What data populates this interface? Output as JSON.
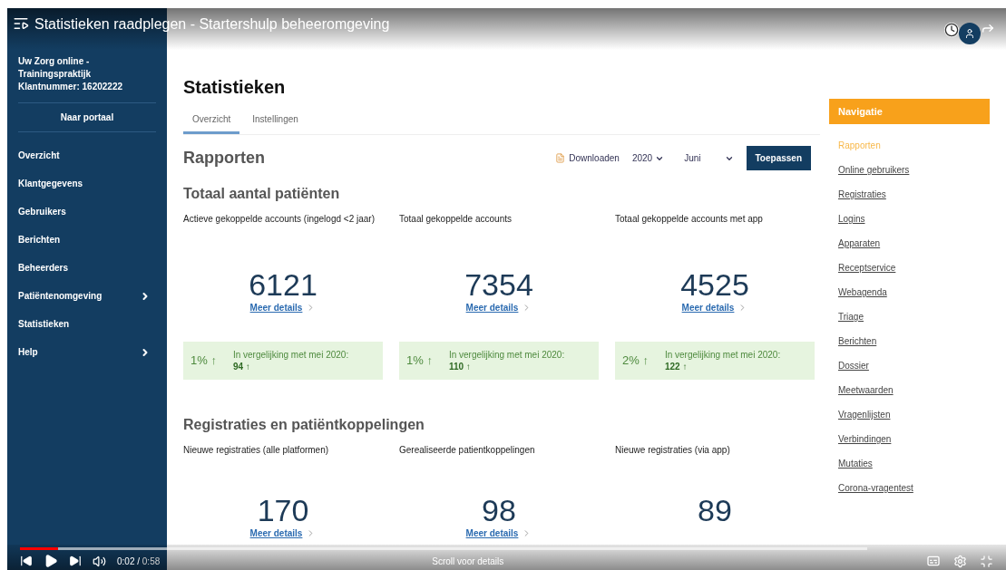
{
  "video": {
    "title": "Statistieken raadplegen - Startershulp beheeromgeving",
    "time_current": "0:02",
    "time_separator": "/",
    "time_total": "0:58",
    "progress": {
      "level": 0.045
    },
    "hint": "Scroll voor details"
  },
  "sidebar": {
    "organisation": "Uw Zorg online - Trainingspraktijk",
    "customer_number": "Klantnummer: 16202222",
    "portal_button": "Naar portaal",
    "items": [
      {
        "label": "Overzicht",
        "submenu": false
      },
      {
        "label": "Klantgegevens",
        "submenu": false
      },
      {
        "label": "Gebruikers",
        "submenu": false
      },
      {
        "label": "Berichten",
        "submenu": false
      },
      {
        "label": "Beheerders",
        "submenu": false
      },
      {
        "label": "Patiëntenomgeving",
        "submenu": true
      },
      {
        "label": "Statistieken",
        "submenu": false
      },
      {
        "label": "Help",
        "submenu": true
      }
    ]
  },
  "page": {
    "title": "Statistieken",
    "tabs": [
      {
        "label": "Overzicht",
        "selected": true
      },
      {
        "label": "Instellingen",
        "selected": false
      }
    ],
    "section_title": "Rapporten",
    "download": "Downloaden",
    "year": "2020",
    "month": "Juni",
    "apply_button": "Toepassen",
    "groups": [
      {
        "title": "Totaal aantal patiënten",
        "stats": [
          {
            "label": "Actieve gekoppelde accounts (ingelogd <2 jaar)",
            "value": "6121",
            "link": "Meer details",
            "change": {
              "percent": "1%",
              "arrow": "↑",
              "text": "In vergelijking met mei 2020:",
              "delta": "94",
              "delta_arrow": "↑"
            }
          },
          {
            "label": "Totaal gekoppelde accounts",
            "value": "7354",
            "link": "Meer details",
            "change": {
              "percent": "1%",
              "arrow": "↑",
              "text": "In vergelijking met mei 2020:",
              "delta": "110",
              "delta_arrow": "↑"
            }
          },
          {
            "label": "Totaal gekoppelde accounts met app",
            "value": "4525",
            "link": "Meer details",
            "change": {
              "percent": "2%",
              "arrow": "↑",
              "text": "In vergelijking met mei 2020:",
              "delta": "122",
              "delta_arrow": "↑"
            }
          }
        ]
      },
      {
        "title": "Registraties en patiëntkoppelingen",
        "stats": [
          {
            "label": "Nieuwe registraties (alle platformen)",
            "value": "170",
            "link": "Meer details"
          },
          {
            "label": "Gerealiseerde patientkoppelingen",
            "value": "98",
            "link": "Meer details"
          },
          {
            "label": "Nieuwe registraties (via app)",
            "value": "89"
          }
        ]
      }
    ]
  },
  "navigation": {
    "title": "Navigatie",
    "items": [
      {
        "label": "Rapporten",
        "selected": true
      },
      {
        "label": "Online gebruikers",
        "selected": false
      },
      {
        "label": "Registraties",
        "selected": false
      },
      {
        "label": "Logins",
        "selected": false
      },
      {
        "label": "Apparaten",
        "selected": false
      },
      {
        "label": "Receptservice",
        "selected": false
      },
      {
        "label": "Webagenda",
        "selected": false
      },
      {
        "label": "Triage",
        "selected": false
      },
      {
        "label": "Berichten",
        "selected": false
      },
      {
        "label": "Dossier",
        "selected": false
      },
      {
        "label": "Meetwaarden",
        "selected": false
      },
      {
        "label": "Vragenlijsten",
        "selected": false
      },
      {
        "label": "Verbindingen",
        "selected": false
      },
      {
        "label": "Mutaties",
        "selected": false
      },
      {
        "label": "Corona-vragentest",
        "selected": false
      }
    ]
  }
}
